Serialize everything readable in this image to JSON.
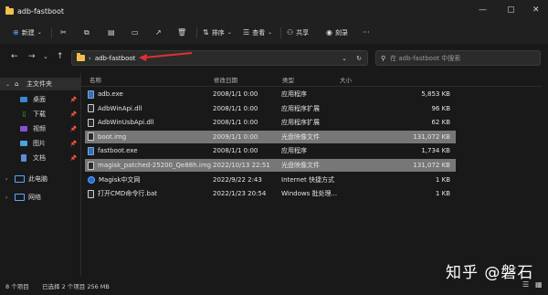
{
  "window": {
    "title": "adb-fastboot",
    "minimize": "—",
    "maximize": "▢",
    "close": "✕"
  },
  "toolbar": {
    "new_label": "新建",
    "sort_label": "排序",
    "view_label": "查看",
    "share_label": "共享",
    "more_label": "刻录"
  },
  "address": {
    "path_chevron": "›",
    "path": "adb-fastboot",
    "dropdown": "⌄",
    "refresh": "↻"
  },
  "search": {
    "placeholder": "在 adb-fastboot 中搜索"
  },
  "sidebar": {
    "items": [
      {
        "label": "主文件夹",
        "icon": "home-icon"
      },
      {
        "label": "桌面",
        "icon": "desktop-icon"
      },
      {
        "label": "下载",
        "icon": "download-icon"
      },
      {
        "label": "视频",
        "icon": "video-icon"
      },
      {
        "label": "图片",
        "icon": "picture-icon"
      },
      {
        "label": "文档",
        "icon": "document-icon"
      },
      {
        "label": "此电脑",
        "icon": "computer-icon"
      },
      {
        "label": "网络",
        "icon": "network-icon"
      }
    ]
  },
  "table": {
    "headers": [
      "名称",
      "修改日期",
      "类型",
      "大小"
    ],
    "rows": [
      {
        "name": "adb.exe",
        "date": "2008/1/1 0:00",
        "type": "应用程序",
        "size": "5,853 KB",
        "selected": false
      },
      {
        "name": "AdbWinApi.dll",
        "date": "2008/1/1 0:00",
        "type": "应用程序扩展",
        "size": "96 KB",
        "selected": false
      },
      {
        "name": "AdbWinUsbApi.dll",
        "date": "2008/1/1 0:00",
        "type": "应用程序扩展",
        "size": "62 KB",
        "selected": false
      },
      {
        "name": "boot.img",
        "date": "2009/1/1 0:00",
        "type": "光盘映像文件",
        "size": "131,072 KB",
        "selected": true
      },
      {
        "name": "fastboot.exe",
        "date": "2008/1/1 0:00",
        "type": "应用程序",
        "size": "1,734 KB",
        "selected": false
      },
      {
        "name": "magisk_patched-25200_Qe88h.img",
        "date": "2022/10/13 22:51",
        "type": "光盘映像文件",
        "size": "131,072 KB",
        "selected": true
      },
      {
        "name": "Magisk中文网",
        "date": "2022/9/22 2:43",
        "type": "Internet 快捷方式",
        "size": "1 KB",
        "selected": false
      },
      {
        "name": "打开CMD命令行.bat",
        "date": "2022/1/23 20:54",
        "type": "Windows 批处理...",
        "size": "1 KB",
        "selected": false
      }
    ]
  },
  "status": {
    "count": "8 个项目",
    "selection": "已选择 2 个项目  256 MB"
  },
  "watermark": "知乎 @磐石",
  "colors": {
    "selected_row": "#777777",
    "folder": "#f2c14b",
    "accent": "#5aa9ff",
    "annotation_arrow": "#e03030"
  }
}
